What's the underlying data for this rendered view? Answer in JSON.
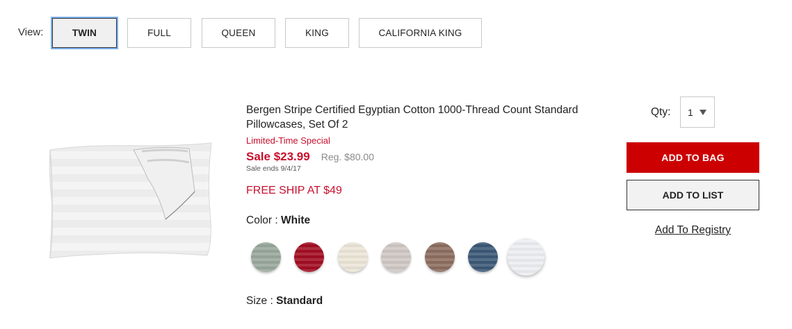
{
  "view": {
    "label": "View:",
    "sizes": [
      {
        "label": "TWIN",
        "active": true
      },
      {
        "label": "FULL",
        "active": false
      },
      {
        "label": "QUEEN",
        "active": false
      },
      {
        "label": "KING",
        "active": false
      },
      {
        "label": "CALIFORNIA KING",
        "active": false
      }
    ]
  },
  "product": {
    "title": "Bergen Stripe Certified Egyptian Cotton 1000-Thread Count Standard Pillowcases, Set Of 2",
    "promo": "Limited-Time Special",
    "sale_price": "Sale $23.99",
    "reg_price": "Reg. $80.00",
    "sale_ends": "Sale ends 9/4/17",
    "free_ship": "FREE SHIP AT $49",
    "color_label": "Color : ",
    "color_value": "White",
    "size_label": "Size : ",
    "size_value": "Standard",
    "swatches": [
      {
        "name": "sage",
        "color": "#9aa89c"
      },
      {
        "name": "red",
        "color": "#a30f24"
      },
      {
        "name": "ivory",
        "color": "#ece6d8"
      },
      {
        "name": "taupe",
        "color": "#cfc8c4"
      },
      {
        "name": "brown",
        "color": "#8d6e60"
      },
      {
        "name": "blue",
        "color": "#3d5a78"
      },
      {
        "name": "white",
        "color": "#eceef2",
        "selected": true
      }
    ]
  },
  "purchase": {
    "qty_label": "Qty:",
    "qty_value": "1",
    "add_to_bag": "ADD TO BAG",
    "add_to_list": "ADD TO LIST",
    "add_to_registry": "Add To Registry"
  },
  "colors": {
    "accent_red": "#cc0000",
    "sale_red": "#c8102e",
    "focus_blue": "#7fb2ee"
  }
}
